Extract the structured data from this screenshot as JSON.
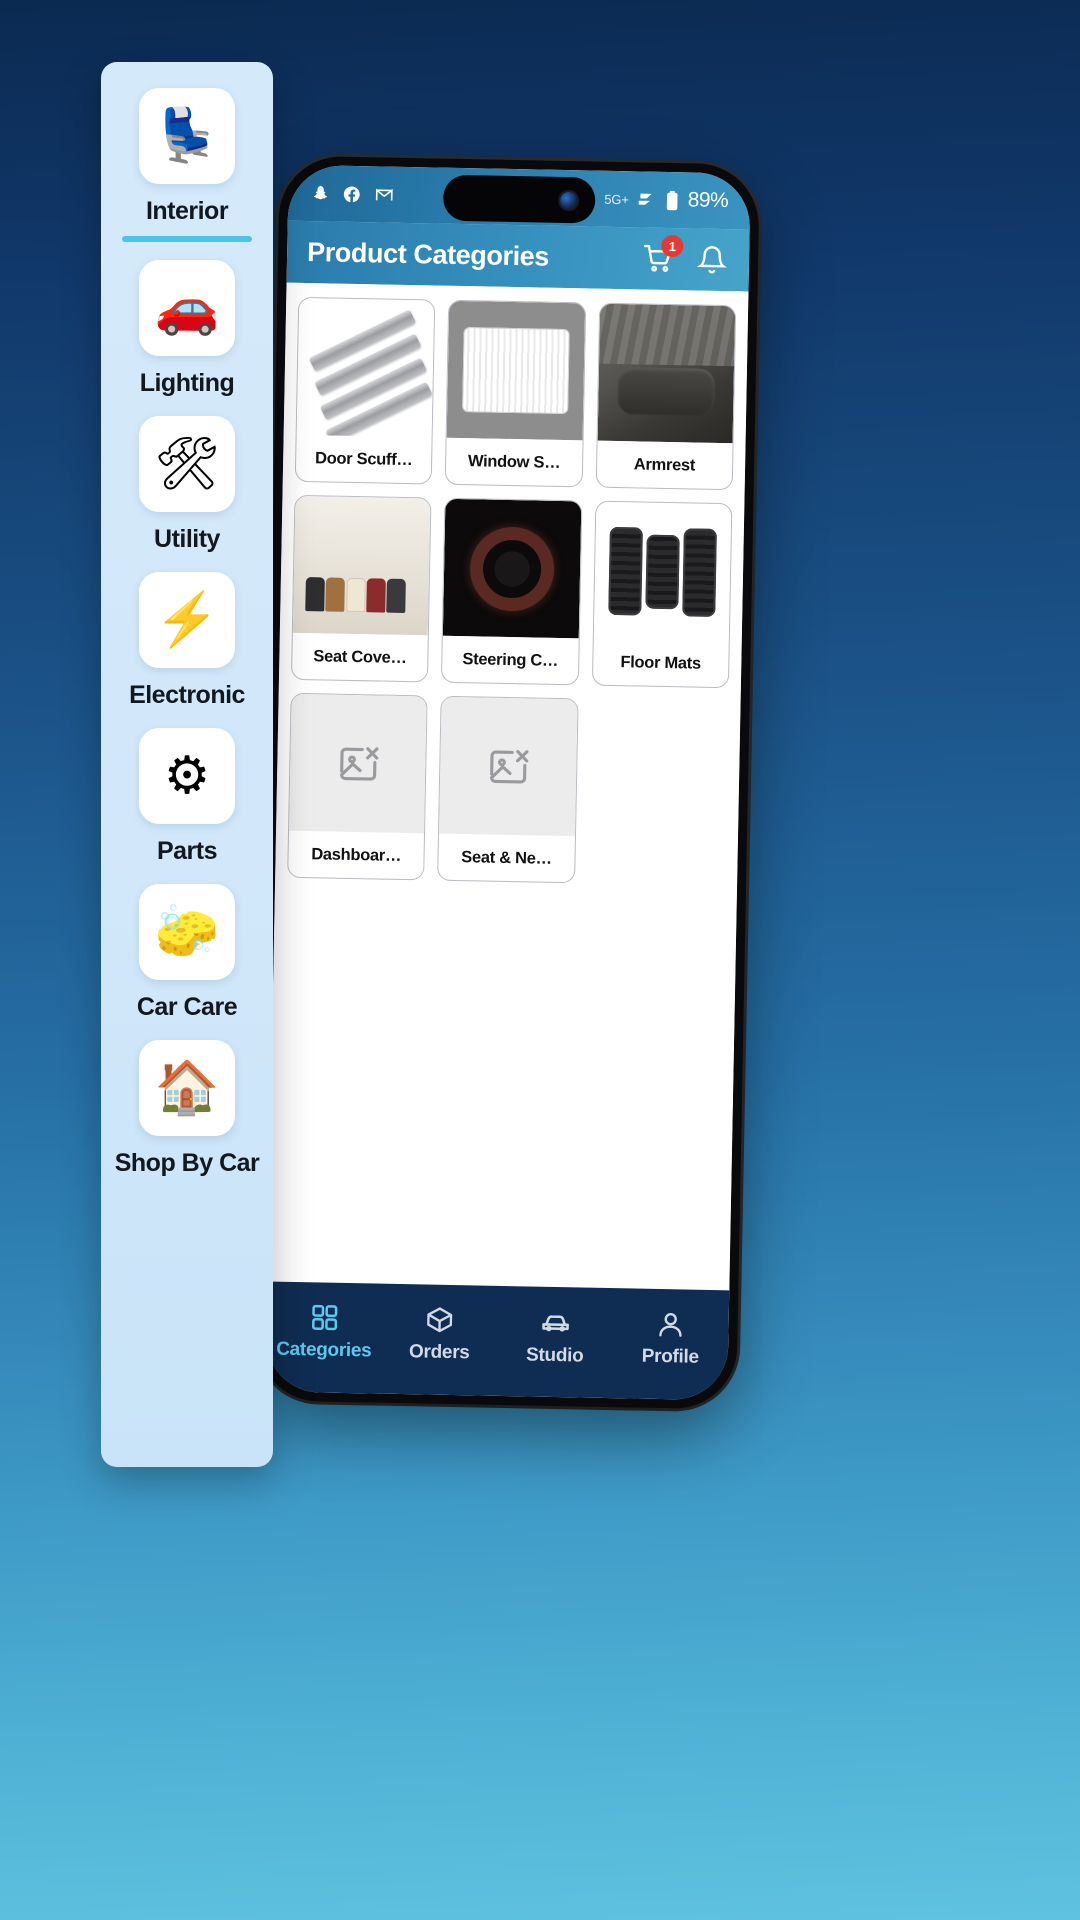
{
  "background": {
    "gradient_top": "#0b2a52",
    "gradient_bottom": "#5ec2e0"
  },
  "statusbar": {
    "left_icons": [
      "snapchat-icon",
      "facebook-icon",
      "gmail-icon"
    ],
    "alarm_icon": "alarm-icon",
    "call_wifi_icon": "call-wifi-icon",
    "data_transfer_icon": "data-transfer-icon",
    "network": "5G+",
    "signal_icon": "signal-bars-icon",
    "battery_icon": "battery-icon",
    "battery_percent": "89%"
  },
  "appbar": {
    "title": "Product Categories",
    "cart_icon": "shopping-cart-icon",
    "cart_badge": "1",
    "bell_icon": "notification-bell-icon"
  },
  "sidebar": {
    "items": [
      {
        "label": "Interior",
        "icon": "car-seats-icon",
        "emoji": "💺",
        "active": true
      },
      {
        "label": "Lighting",
        "icon": "car-headlight-icon",
        "emoji": "🚙",
        "active": false
      },
      {
        "label": "Utility",
        "icon": "car-utility-icon",
        "emoji": "🛠️",
        "active": false
      },
      {
        "label": "Electronic",
        "icon": "car-electronic-icon",
        "emoji": "⚡",
        "active": false
      },
      {
        "label": "Parts",
        "icon": "car-parts-icon",
        "emoji": "⚙️",
        "active": false
      },
      {
        "label": "Car Care",
        "icon": "car-wash-icon",
        "emoji": "🧽",
        "active": false
      },
      {
        "label": "Shop By Car",
        "icon": "car-garage-icon",
        "emoji": "🏠",
        "active": false
      }
    ]
  },
  "products": [
    {
      "label": "Door Scuff…",
      "art": "scuff",
      "placeholder": false
    },
    {
      "label": "Window S…",
      "art": "shade",
      "placeholder": false
    },
    {
      "label": "Armrest",
      "art": "armrest",
      "placeholder": false
    },
    {
      "label": "Seat Cove…",
      "art": "seatcover",
      "placeholder": false
    },
    {
      "label": "Steering C…",
      "art": "steering",
      "placeholder": false
    },
    {
      "label": "Floor Mats",
      "art": "mats",
      "placeholder": false
    },
    {
      "label": "Dashboar…",
      "art": "none",
      "placeholder": true
    },
    {
      "label": "Seat & Ne…",
      "art": "none",
      "placeholder": true
    }
  ],
  "bottomnav": {
    "items": [
      {
        "label": "Categories",
        "icon": "grid-icon",
        "active": true
      },
      {
        "label": "Orders",
        "icon": "box-icon",
        "active": false
      },
      {
        "label": "Studio",
        "icon": "car-icon",
        "active": false
      },
      {
        "label": "Profile",
        "icon": "person-icon",
        "active": false
      }
    ]
  },
  "colors": {
    "accent": "#4ec3e8",
    "navbar": "#0f2d52",
    "badge": "#e53935",
    "header": "#3792bf"
  }
}
